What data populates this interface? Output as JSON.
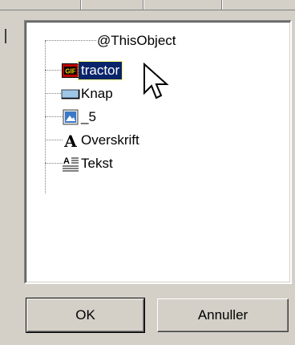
{
  "tree": {
    "items": [
      {
        "label": "@ThisObject",
        "icon": "none"
      },
      {
        "label": "tractor",
        "icon": "gif-image-icon",
        "selected": true
      },
      {
        "label": "Knap",
        "icon": "button-control-icon"
      },
      {
        "label": "_5",
        "icon": "picture-icon"
      },
      {
        "label": "Overskrift",
        "icon": "heading-a-icon"
      },
      {
        "label": "Tekst",
        "icon": "text-block-icon"
      }
    ]
  },
  "buttons": {
    "ok_label": "OK",
    "cancel_label": "Annuller"
  },
  "colors": {
    "selection": "#0a246a",
    "face": "#d4d0c8"
  }
}
